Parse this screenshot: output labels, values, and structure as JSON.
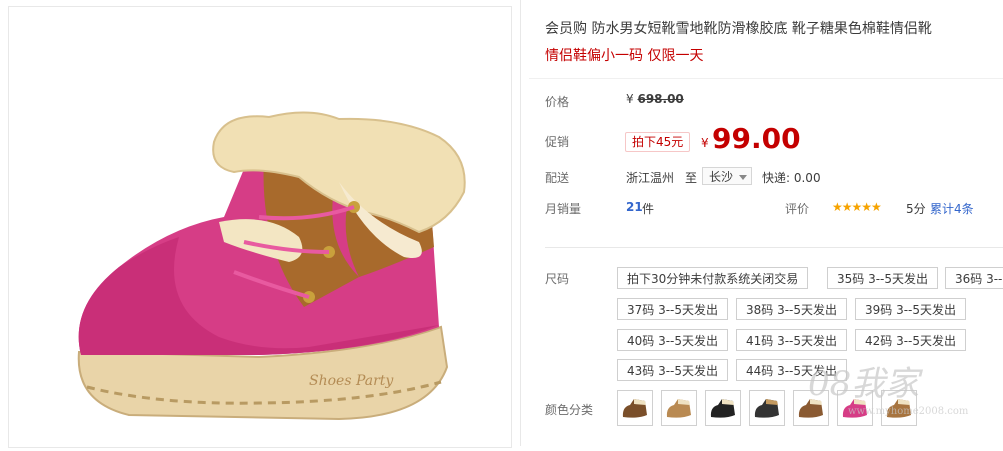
{
  "product": {
    "title": "会员购 防水男女短靴雪地靴防滑橡胶底 靴子糖果色棉鞋情侣靴",
    "subtitle": "情侣鞋偏小一码 仅限一天"
  },
  "price": {
    "label": "价格",
    "currency": "¥",
    "original": "698.00"
  },
  "promo": {
    "label": "促销",
    "tag": "拍下45元",
    "currency": "¥",
    "price": "99.00"
  },
  "delivery": {
    "label": "配送",
    "from": "浙江温州",
    "to_word": "至",
    "to_city": "长沙",
    "shipping": "快递: 0.00"
  },
  "sales": {
    "label": "月销量",
    "count": "21",
    "unit": "件"
  },
  "review": {
    "label": "评价",
    "stars": "★★★★★",
    "score": "5分",
    "total": "累计4条"
  },
  "size": {
    "label": "尺码",
    "options": [
      "拍下30分钟未付款系统关闭交易",
      "35码 3--5天发出",
      "36码 3--",
      "37码 3--5天发出",
      "38码 3--5天发出",
      "39码 3--5天发出",
      "40码 3--5天发出",
      "41码 3--5天发出",
      "42码 3--5天发出",
      "43码 3--5天发出",
      "44码 3--5天发出"
    ]
  },
  "color": {
    "label": "颜色分类",
    "swatches": [
      "brown",
      "tan",
      "black",
      "black-tan",
      "chestnut",
      "rose",
      "camel"
    ]
  },
  "colors": {
    "accent": "#c40000",
    "boot": "#d63d86",
    "fur": "#f1e0b4",
    "sole": "#e8cfa0"
  },
  "watermark": {
    "text": "08我家",
    "url": "www.myhome2008.com"
  }
}
